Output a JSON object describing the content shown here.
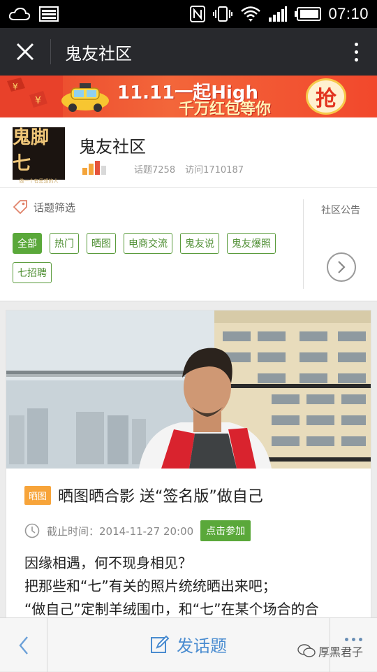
{
  "status_bar": {
    "time": "07:10",
    "icons": [
      "cloud-icon",
      "image-icon",
      "nfc-icon",
      "vibrate-icon",
      "wifi-icon",
      "signal-icon",
      "battery-icon"
    ]
  },
  "app_bar": {
    "title": "鬼友社区",
    "close_icon": "close-icon",
    "menu_icon": "more-vertical-icon"
  },
  "banner": {
    "line1": "11.11一起High",
    "line2": "千万红包等你",
    "grab": "抢"
  },
  "community": {
    "logo_text": "鬼脚七",
    "logo_sub": "做一个有思想的人",
    "name": "鬼友社区",
    "topics": "话题7258",
    "visits": "访问1710187"
  },
  "filter": {
    "label": "话题筛选",
    "tags": [
      "全部",
      "热门",
      "晒图",
      "电商交流",
      "鬼友说",
      "鬼友爆照",
      "七招聘"
    ],
    "active_index": 0,
    "notice_label": "社区公告"
  },
  "post": {
    "badge": "晒图",
    "title": "晒图晒合影 送“签名版”做自己",
    "deadline": "截止时间：2014-11-27 20:00",
    "join": "点击参加",
    "lines": [
      "因缘相遇，何不现身相见？",
      "把那些和“七”有关的照片统统晒出来吧；",
      "“做自己”定制羊绒围巾，和“七”在某个场合的合"
    ]
  },
  "bottom_bar": {
    "post_label": "发话题",
    "watermark": "厚黑君子"
  },
  "colors": {
    "accent_green": "#5aa83a",
    "badge_orange": "#f7a43a",
    "appbar": "#28292d",
    "link_blue": "#4a8cd0"
  }
}
